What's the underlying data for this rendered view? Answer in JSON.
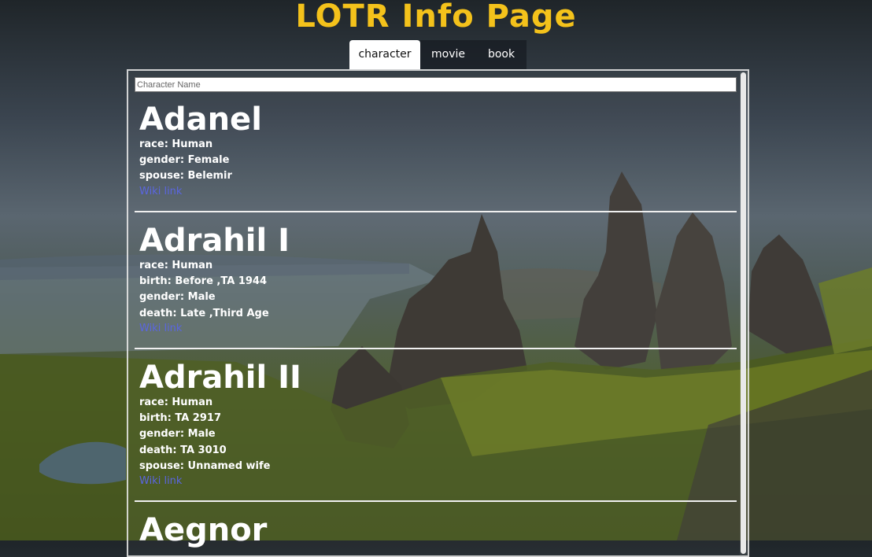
{
  "header": {
    "title": "LOTR Info Page"
  },
  "tabs": [
    {
      "label": "character",
      "active": true
    },
    {
      "label": "movie",
      "active": false
    },
    {
      "label": "book",
      "active": false
    }
  ],
  "search": {
    "placeholder": "Character Name",
    "value": ""
  },
  "characters": [
    {
      "name": "Adanel",
      "fields": [
        "race: Human",
        "gender: Female",
        "spouse: Belemir"
      ],
      "link": "Wiki link"
    },
    {
      "name": "Adrahil I",
      "fields": [
        "race: Human",
        "birth: Before ,TA 1944",
        "gender: Male",
        "death: Late ,Third Age"
      ],
      "link": "Wiki link"
    },
    {
      "name": "Adrahil II",
      "fields": [
        "race: Human",
        "birth: TA 2917",
        "gender: Male",
        "death: TA 3010",
        "spouse: Unnamed wife"
      ],
      "link": "Wiki link"
    },
    {
      "name": "Aegnor",
      "fields": [],
      "link": ""
    }
  ],
  "colors": {
    "title": "#f4c21b",
    "link": "#5a66e0",
    "tab_active_bg": "#ffffff",
    "tab_bg": "#1e252b"
  }
}
